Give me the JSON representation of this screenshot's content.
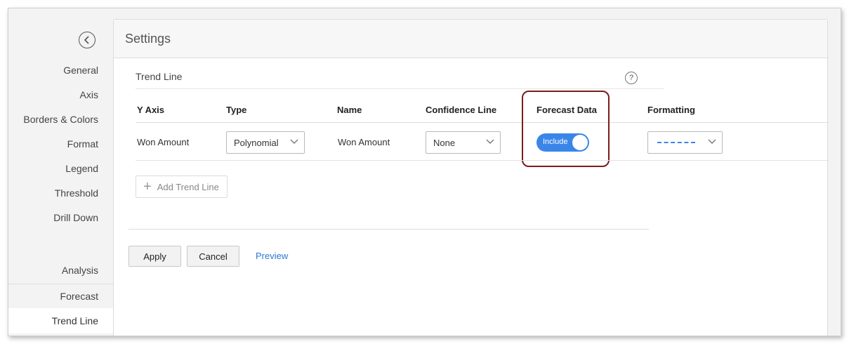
{
  "sidebar": {
    "items": [
      {
        "label": "General"
      },
      {
        "label": "Axis"
      },
      {
        "label": "Borders & Colors"
      },
      {
        "label": "Format"
      },
      {
        "label": "Legend"
      },
      {
        "label": "Threshold"
      },
      {
        "label": "Drill Down"
      },
      {
        "label": "Analysis"
      },
      {
        "label": "Forecast"
      },
      {
        "label": "Trend Line"
      }
    ],
    "active": "Trend Line"
  },
  "header": {
    "title": "Settings"
  },
  "trend_line": {
    "section_title": "Trend Line",
    "help_glyph": "?",
    "columns": {
      "y_axis": "Y Axis",
      "type": "Type",
      "name": "Name",
      "confidence": "Confidence Line",
      "forecast": "Forecast Data",
      "formatting": "Formatting"
    },
    "row": {
      "y_axis": "Won Amount",
      "type": "Polynomial",
      "name": "Won Amount",
      "confidence": "None",
      "forecast_toggle_label": "Include",
      "forecast_toggle_on": true
    },
    "add_label": "Add Trend Line"
  },
  "actions": {
    "apply": "Apply",
    "cancel": "Cancel",
    "preview": "Preview"
  },
  "colors": {
    "accent": "#3a86e8",
    "highlight_border": "#7a1d1d",
    "link": "#2a7ad6"
  }
}
